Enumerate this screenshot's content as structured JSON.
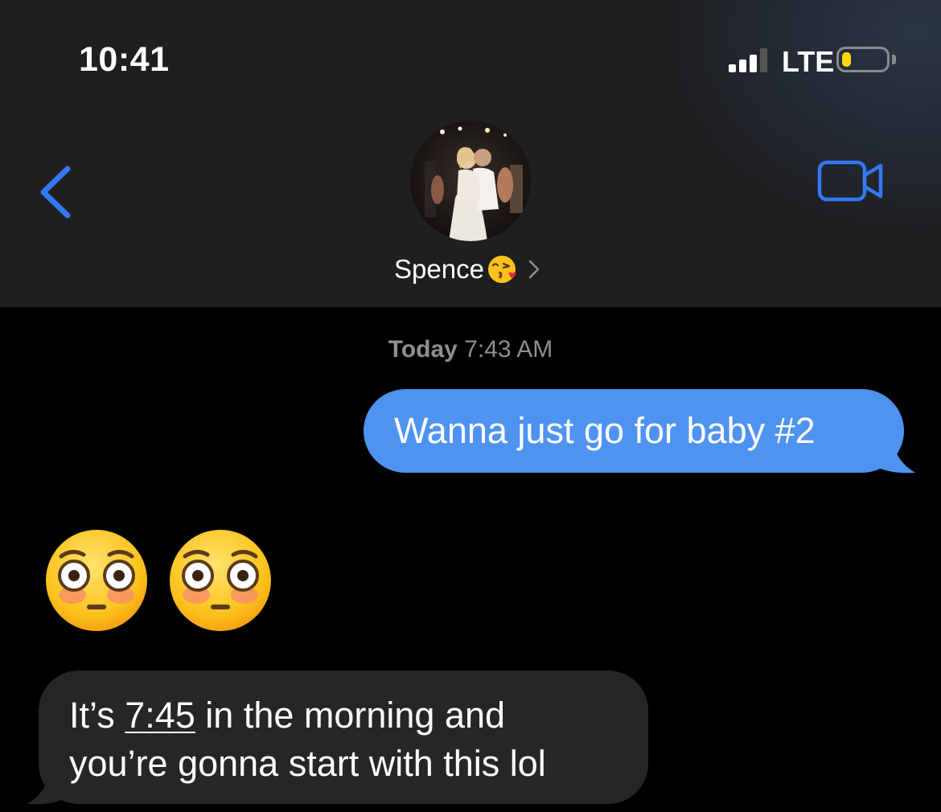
{
  "status_bar": {
    "time": "10:41",
    "network": "LTE",
    "signal_bars_active": 3,
    "signal_bars_total": 4,
    "battery_level": 0.22,
    "battery_color": "#ffd60a"
  },
  "nav": {
    "back_icon": "chevron-left-icon",
    "video_icon": "facetime-video-icon",
    "contact_name": "Spence",
    "contact_emoji": "face-blowing-kiss-emoji",
    "chevron_icon": "chevron-right-icon"
  },
  "conversation": {
    "timestamp_day": "Today",
    "timestamp_time": "7:43 AM",
    "messages": [
      {
        "direction": "outgoing",
        "text": "Wanna just go for baby #2"
      },
      {
        "direction": "incoming",
        "emoji": [
          "flushed-face-emoji",
          "flushed-face-emoji"
        ]
      },
      {
        "direction": "incoming",
        "line1_prefix": "It’s ",
        "line1_link": "7:45",
        "line1_suffix": " in the morning and",
        "line2": "you’re gonna start with this lol"
      }
    ]
  },
  "colors": {
    "accent": "#3478f6",
    "outgoing_bubble": "#4f93f0",
    "incoming_bubble": "#262629",
    "header_bg": "#1f1f21"
  }
}
